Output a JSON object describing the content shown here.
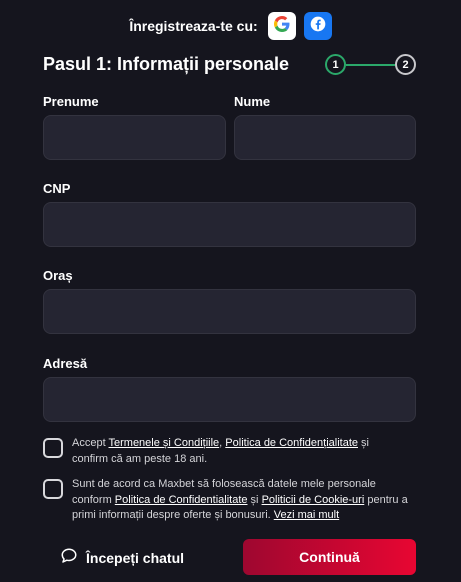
{
  "social": {
    "label": "Înregistreaza-te cu:",
    "google_icon": "google-icon",
    "facebook_icon": "facebook-icon"
  },
  "step": {
    "title": "Pasul 1: Informații personale",
    "current": "1",
    "next": "2"
  },
  "fields": {
    "first_name": {
      "label": "Prenume",
      "value": ""
    },
    "last_name": {
      "label": "Nume",
      "value": ""
    },
    "cnp": {
      "label": "CNP",
      "value": ""
    },
    "city": {
      "label": "Oraș",
      "value": ""
    },
    "address": {
      "label": "Adresă",
      "value": ""
    }
  },
  "consents": {
    "terms": {
      "prefix": "Accept ",
      "link_terms": "Termenele și Condițiile",
      "sep": ", ",
      "link_privacy": "Politica de Confidențialitate",
      "suffix": " și confirm că am peste 18 ani."
    },
    "marketing": {
      "prefix": "Sunt de acord ca Maxbet să folosească datele mele personale conform ",
      "link_privacy": "Politica de Confidentialitate",
      "mid": " și ",
      "link_cookies": "Politicii de Cookie-uri",
      "suffix": " pentru a primi informații despre oferte și bonusuri. ",
      "link_more": "Vezi mai mult"
    }
  },
  "footer": {
    "chat_label": "Începeți chatul",
    "continue_label": "Continuă"
  },
  "colors": {
    "background": "#15151e",
    "input_bg": "#252532",
    "step_active": "#2ba86a",
    "button_start": "#9e0730",
    "button_end": "#e80632"
  }
}
